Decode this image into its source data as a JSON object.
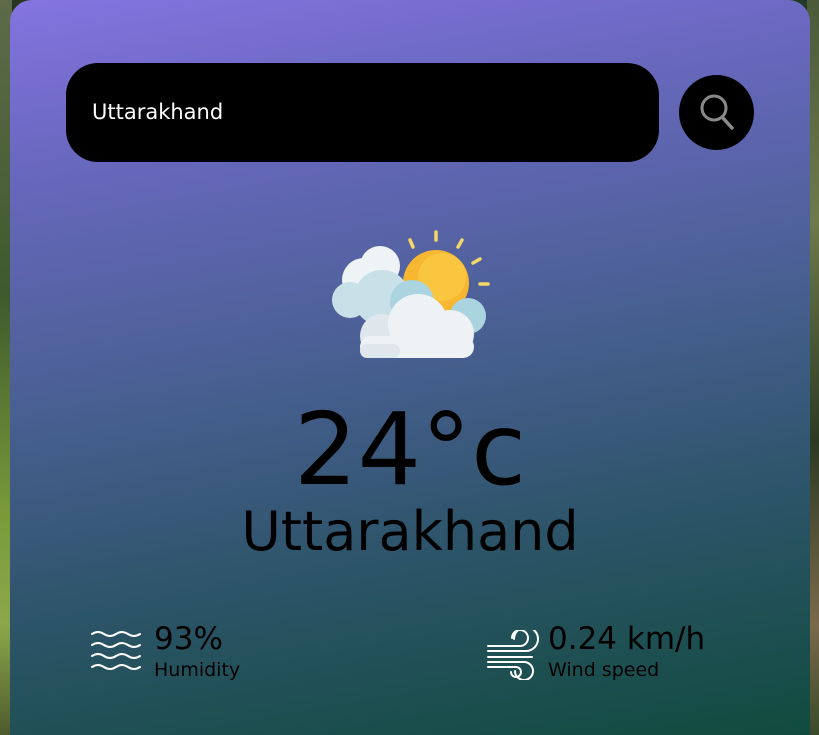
{
  "search": {
    "value": "Uttarakhand",
    "placeholder": ""
  },
  "weather": {
    "icon": "partly-cloudy-icon",
    "temperature": "24°c",
    "city": "Uttarakhand"
  },
  "details": {
    "humidity": {
      "value": "93%",
      "label": "Humidity",
      "icon": "humidity-waves-icon"
    },
    "wind": {
      "value": "0.24 km/h",
      "label": "Wind speed",
      "icon": "wind-icon"
    }
  },
  "colors": {
    "card_top": "#8474e0",
    "card_bottom": "#0e4a3a",
    "search_bg": "#000000",
    "text": "#000000"
  }
}
